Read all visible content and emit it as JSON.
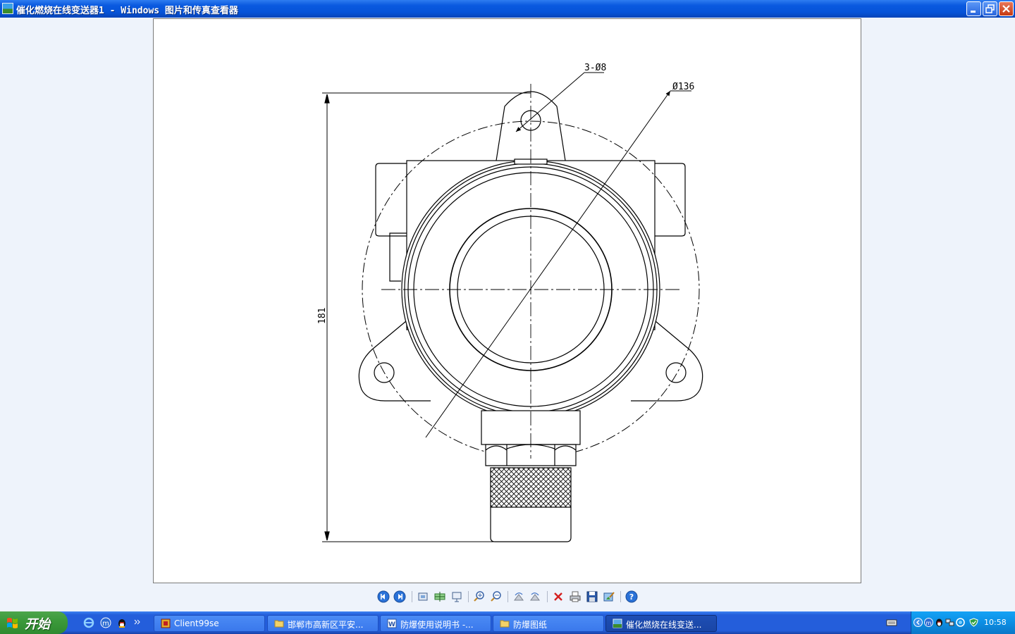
{
  "window": {
    "title": "催化燃烧在线变送器1 - Windows 图片和传真查看器",
    "controls": [
      "minimize",
      "restore",
      "close"
    ]
  },
  "drawing": {
    "annotations": {
      "hole_callout": "3-Ø8",
      "diameter_callout": "Ø136",
      "height_dimension": "181"
    }
  },
  "viewer_toolbar": {
    "buttons": [
      {
        "name": "previous-image",
        "icon": "prev-icon"
      },
      {
        "name": "next-image",
        "icon": "next-icon"
      },
      {
        "name": "best-fit",
        "icon": "best-fit-icon"
      },
      {
        "name": "actual-size",
        "icon": "actual-size-icon"
      },
      {
        "name": "slideshow",
        "icon": "slideshow-icon"
      },
      {
        "name": "zoom-in",
        "icon": "zoom-in-icon"
      },
      {
        "name": "zoom-out",
        "icon": "zoom-out-icon"
      },
      {
        "name": "rotate-clockwise",
        "icon": "rotate-cw-icon"
      },
      {
        "name": "rotate-counterclockwise",
        "icon": "rotate-ccw-icon"
      },
      {
        "name": "delete",
        "icon": "delete-icon"
      },
      {
        "name": "print",
        "icon": "print-icon"
      },
      {
        "name": "copy-to",
        "icon": "save-icon"
      },
      {
        "name": "open-for-editing",
        "icon": "edit-icon"
      },
      {
        "name": "help",
        "icon": "help-icon"
      }
    ]
  },
  "taskbar": {
    "start_label": "开始",
    "tasks": [
      {
        "label": "Client99se",
        "active": false
      },
      {
        "label": "邯郸市高新区平安...",
        "active": false
      },
      {
        "label": "防爆使用说明书 -...",
        "active": false
      },
      {
        "label": "防爆图纸",
        "active": false
      },
      {
        "label": "催化燃烧在线变送...",
        "active": true
      }
    ],
    "clock": "10:58"
  }
}
